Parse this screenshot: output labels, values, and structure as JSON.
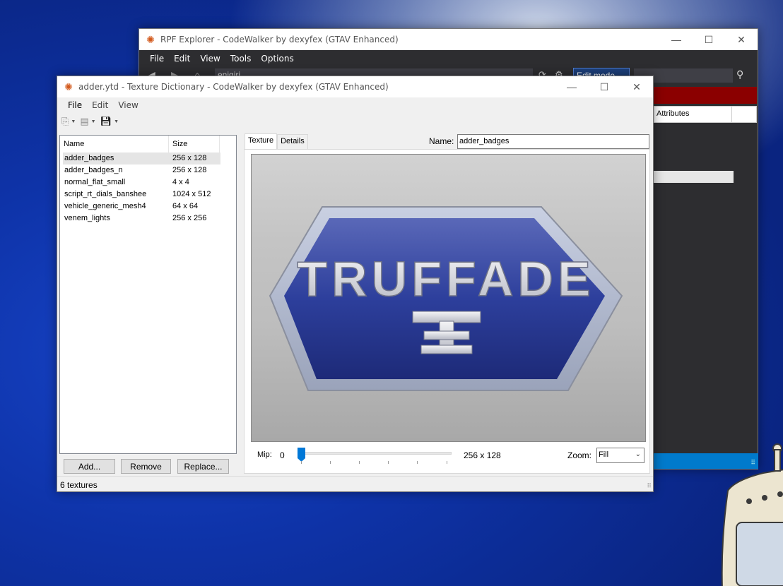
{
  "rpf_window": {
    "title": "RPF Explorer - CodeWalker by dexyfex (GTAV Enhanced)",
    "menu": [
      "File",
      "Edit",
      "View",
      "Tools",
      "Options"
    ],
    "address": "enigiri",
    "edit_mode_label": "Edit mode",
    "attributes_header": "Attributes",
    "status_color": "#007acc",
    "header_color": "#8b0000"
  },
  "ytd_window": {
    "title": "adder.ytd - Texture Dictionary - CodeWalker by dexyfex (GTAV Enhanced)",
    "menu": [
      "File",
      "Edit",
      "View"
    ],
    "list": {
      "columns": [
        "Name",
        "Size"
      ],
      "rows": [
        {
          "name": "adder_badges",
          "size": "256 x 128",
          "selected": true
        },
        {
          "name": "adder_badges_n",
          "size": "256 x 128",
          "selected": false
        },
        {
          "name": "normal_flat_small",
          "size": "4 x 4",
          "selected": false
        },
        {
          "name": "script_rt_dials_banshee",
          "size": "1024 x 512",
          "selected": false
        },
        {
          "name": "vehicle_generic_mesh4",
          "size": "64 x 64",
          "selected": false
        },
        {
          "name": "venem_lights",
          "size": "256 x 256",
          "selected": false
        }
      ]
    },
    "buttons": {
      "add": "Add...",
      "remove": "Remove",
      "replace": "Replace..."
    },
    "tabs": [
      "Texture",
      "Details"
    ],
    "name_label": "Name:",
    "name_value": "adder_badges",
    "preview_text": "TRUFFADE",
    "preview_monogram": "T",
    "mip_label": "Mip:",
    "mip_value": "0",
    "mip_size": "256 x 128",
    "zoom_label": "Zoom:",
    "zoom_value": "Fill",
    "status": "6 textures",
    "accent_color": "#0078d7"
  }
}
